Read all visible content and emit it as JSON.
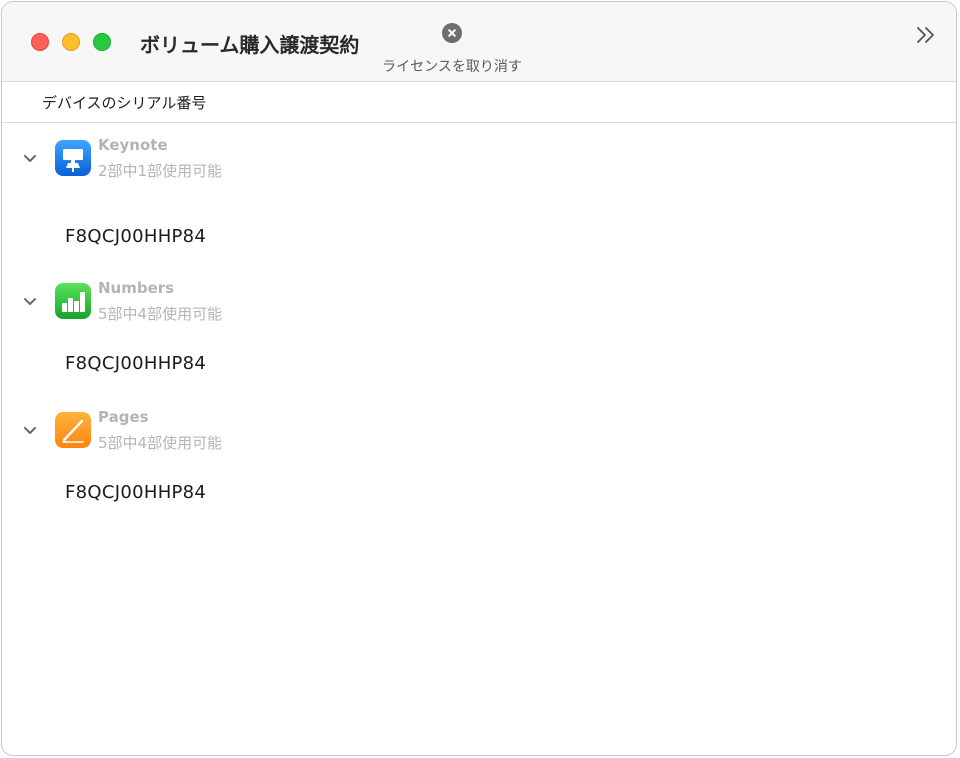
{
  "window": {
    "title": "ボリューム購入譲渡契約"
  },
  "toolbar": {
    "revoke_label": "ライセンスを取り消す",
    "revoke_icon": "x-circle-icon",
    "overflow_icon": "double-chevron-right-icon"
  },
  "table": {
    "column_header": "デバイスのシリアル番号"
  },
  "apps": [
    {
      "name": "Keynote",
      "availability": "2部中1部使用可能",
      "icon": "keynote-app-icon",
      "expanded": true,
      "serials": [
        "F8QCJ00HHP84"
      ]
    },
    {
      "name": "Numbers",
      "availability": "5部中4部使用可能",
      "icon": "numbers-app-icon",
      "expanded": true,
      "serials": [
        "F8QCJ00HHP84"
      ]
    },
    {
      "name": "Pages",
      "availability": "5部中4部使用可能",
      "icon": "pages-app-icon",
      "expanded": true,
      "serials": [
        "F8QCJ00HHP84"
      ]
    }
  ],
  "colors": {
    "close": "#ff5f57",
    "minimize": "#febc2e",
    "maximize": "#28c840",
    "keynote": "#1a7ff5",
    "numbers": "#2fc53c",
    "pages": "#ff9a1f"
  }
}
